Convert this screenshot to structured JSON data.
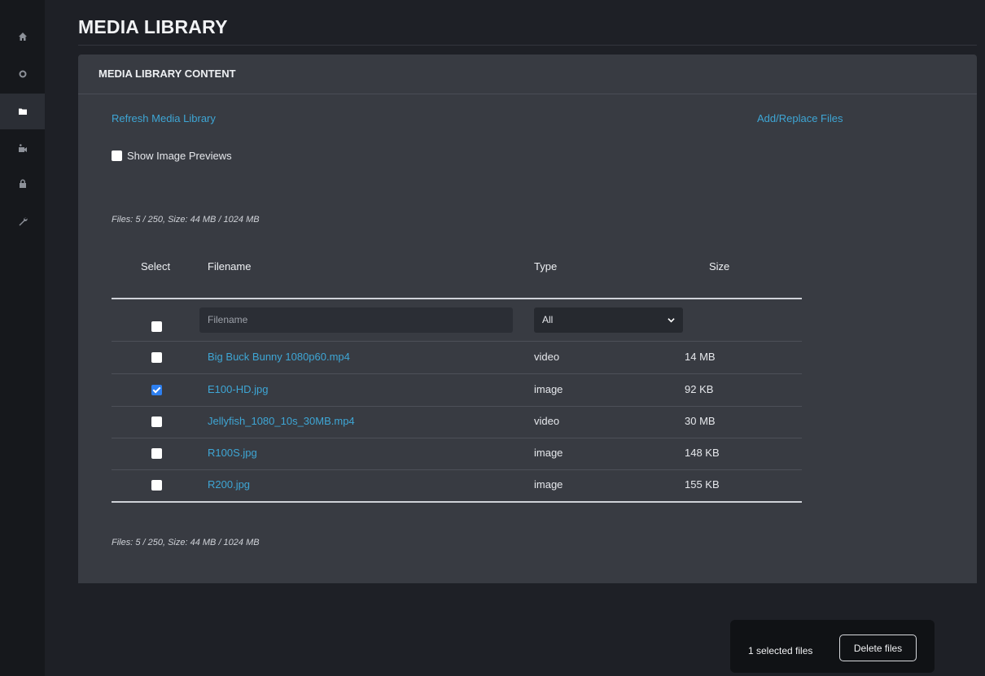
{
  "sidebar": {
    "items": [
      {
        "icon": "home-icon",
        "active": false
      },
      {
        "icon": "gear-icon",
        "active": false
      },
      {
        "icon": "folder-icon",
        "active": true
      },
      {
        "icon": "video-camera-icon",
        "active": false
      },
      {
        "icon": "lock-icon",
        "active": false
      },
      {
        "icon": "wrench-icon",
        "active": false
      }
    ]
  },
  "page": {
    "title": "MEDIA LIBRARY"
  },
  "panel": {
    "title": "MEDIA LIBRARY CONTENT",
    "refresh_link": "Refresh Media Library",
    "add_link": "Add/Replace Files",
    "show_previews_label": "Show Image Previews",
    "show_previews_checked": false,
    "file_info_top": "Files: 5 / 250, Size: 44 MB / 1024 MB",
    "file_info_bottom": "Files: 5 / 250, Size: 44 MB / 1024 MB"
  },
  "table": {
    "headers": {
      "select": "Select",
      "filename": "Filename",
      "type": "Type",
      "size": "Size"
    },
    "filter": {
      "filename_placeholder": "Filename",
      "type_selected": "All"
    },
    "rows": [
      {
        "filename": "Big Buck Bunny 1080p60.mp4",
        "type": "video",
        "size": "14 MB",
        "selected": false
      },
      {
        "filename": "E100-HD.jpg",
        "type": "image",
        "size": "92 KB",
        "selected": true
      },
      {
        "filename": "Jellyfish_1080_10s_30MB.mp4",
        "type": "video",
        "size": "30 MB",
        "selected": false
      },
      {
        "filename": "R100S.jpg",
        "type": "image",
        "size": "148 KB",
        "selected": false
      },
      {
        "filename": "R200.jpg",
        "type": "image",
        "size": "155 KB",
        "selected": false
      }
    ]
  },
  "footer": {
    "selected_text": "1 selected files",
    "delete_label": "Delete files"
  },
  "colors": {
    "accent_link": "#3ea6d5",
    "checkbox_checked": "#2d7ff0",
    "panel_bg": "#383b42",
    "page_bg": "#1e2026"
  }
}
